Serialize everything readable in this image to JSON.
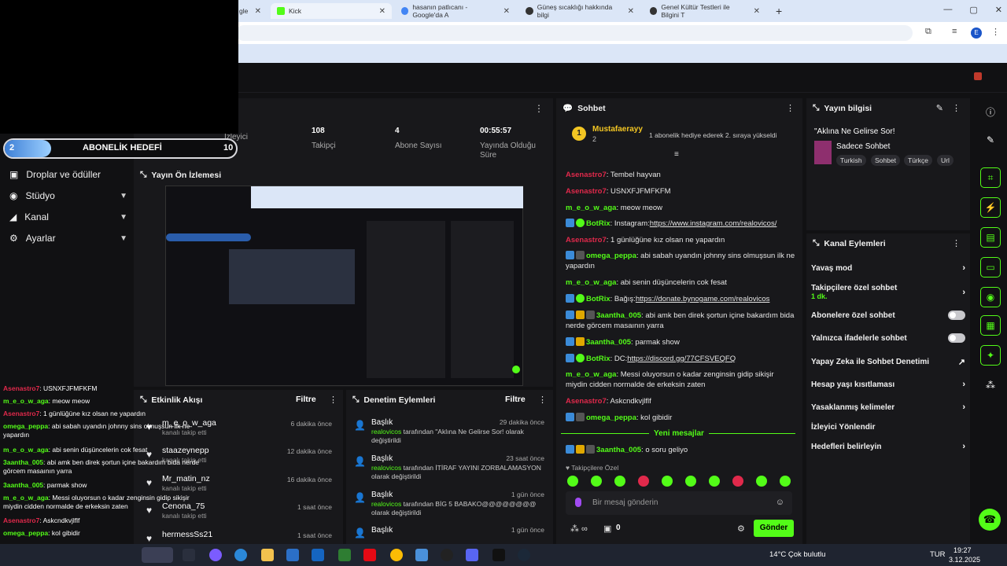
{
  "browser": {
    "tabs": [
      {
        "title": "gle"
      },
      {
        "title": "Kick"
      },
      {
        "title": "hasanın patlıcanı - Google'da A"
      },
      {
        "title": "Güneş sıcaklığı hakkında bilgi"
      },
      {
        "title": "Genel Kültür Testleri ile Bilgini T"
      }
    ],
    "new_tab": "+",
    "controls": [
      "—",
      "▢",
      "✕"
    ],
    "profile": "E"
  },
  "goal": {
    "level": "2",
    "label": "ABONELİK HEDEFİ",
    "target": "10",
    "progress_fraction": 0.2
  },
  "stats": [
    {
      "value": "",
      "label": "İzleyici"
    },
    {
      "value": "108",
      "label": "Takipçi"
    },
    {
      "value": "4",
      "label": "Abone Sayısı"
    },
    {
      "value": "00:55:57",
      "label": "Yayında Olduğu Süre"
    }
  ],
  "sidebar": {
    "items": [
      {
        "label": "Droplar ve ödüller"
      },
      {
        "label": "Stüdyo"
      },
      {
        "label": "Kanal"
      },
      {
        "label": "Ayarlar"
      }
    ]
  },
  "preview": {
    "title": "Yayın Ön İzlemesi"
  },
  "activity": {
    "title": "Etkinlik Akışı",
    "filter": "Filtre",
    "items": [
      {
        "name": "m_e_o_w_aga",
        "sub": "kanalı takip etti",
        "time": "6 dakika önce"
      },
      {
        "name": "staazeynepp",
        "sub": "kanalı takip etti",
        "time": "12 dakika önce"
      },
      {
        "name": "Mr_matin_nz",
        "sub": "kanalı takip etti",
        "time": "16 dakika önce"
      },
      {
        "name": "Cenona_75",
        "sub": "kanalı takip etti",
        "time": "1 saat önce"
      },
      {
        "name": "hermessSs21",
        "sub": "",
        "time": "1 saat önce"
      }
    ]
  },
  "moderation": {
    "title": "Denetim Eylemleri",
    "filter": "Filtre",
    "items": [
      {
        "title": "Başlık",
        "time": "29 dakika önce",
        "actor": "realovicos",
        "text": " tarafından \"Aklına Ne Gelirse Sor! olarak değiştirildi"
      },
      {
        "title": "Başlık",
        "time": "23 saat önce",
        "actor": "realovicos",
        "text": " tarafından İTİRAF YAYINI ZORBALAMASYON olarak değiştirildi"
      },
      {
        "title": "Başlık",
        "time": "1 gün önce",
        "actor": "realovicos",
        "text": " tarafından BİG 5 BABAKO@@@@@@@@ olarak değiştirildi"
      },
      {
        "title": "Başlık",
        "time": "1 gün önce",
        "actor": "",
        "text": ""
      }
    ]
  },
  "overlay_chat": [
    {
      "user": "Asenastro7",
      "msg": "USNXFJFMFKFM",
      "color": "red"
    },
    {
      "user": "m_e_o_w_aga",
      "msg": "meow meow",
      "color": "green"
    },
    {
      "user": "Asenastro7",
      "msg": "1 günlüğüne kız olsan ne yapardın",
      "color": "red"
    },
    {
      "user": "omega_peppa",
      "msg": "abi sabah uyandın johnny sins olmuşsun ilk ne yapardın",
      "color": "green"
    },
    {
      "user": "m_e_o_w_aga",
      "msg": "abi senin düşüncelerin cok fesat",
      "color": "green"
    },
    {
      "user": "3aantha_005",
      "msg": "abi amk ben direk şortun içine bakardım bida nerde görcem masaının yarra",
      "color": "green"
    },
    {
      "user": "3aantha_005",
      "msg": "parmak show",
      "color": "green"
    },
    {
      "user": "m_e_o_w_aga",
      "msg": "Messi oluyorsun o kadar zenginsin gidip sikişir miydin cidden normalde de erkeksin zaten",
      "color": "green"
    },
    {
      "user": "Asenastro7",
      "msg": "Askcndkvjlflf",
      "color": "red"
    },
    {
      "user": "omega_peppa",
      "msg": "kol gibidir",
      "color": "green"
    }
  ],
  "chat": {
    "title": "Sohbet",
    "pinned_user": "Mustafaerayy",
    "pinned_count": "2",
    "pinned_msg": "1 abonelik hediye ederek 2. sıraya yükseldi",
    "messages": [
      {
        "user": "Asenastro7",
        "msg": "Tembel hayvan",
        "color": "red"
      },
      {
        "user": "Asenastro7",
        "msg": "USNXFJFMFKFM",
        "color": "red"
      },
      {
        "user": "m_e_o_w_aga",
        "msg": "meow meow",
        "color": "green"
      },
      {
        "user": "BotRix",
        "msg": "Instagram:",
        "link": "https://www.instagram.com/realovicos/",
        "color": "green"
      },
      {
        "user": "Asenastro7",
        "msg": "1 günlüğüne kız olsan ne yapardın",
        "color": "red"
      },
      {
        "user": "omega_peppa",
        "msg": "abi sabah uyandın johnny sins olmuşsun ilk ne yapardın",
        "color": "green"
      },
      {
        "user": "m_e_o_w_aga",
        "msg": "abi senin düşüncelerin cok fesat",
        "color": "green"
      },
      {
        "user": "BotRix",
        "msg": "Bağış:",
        "link": "https://donate.bynogame.com/realovicos",
        "color": "green"
      },
      {
        "user": "3aantha_005",
        "msg": "abi amk ben direk şortun içine bakardım bida nerde görcem masaının yarra",
        "color": "green"
      },
      {
        "user": "3aantha_005",
        "msg": "parmak show",
        "color": "green"
      },
      {
        "user": "BotRix",
        "msg": "DC:",
        "link": "https://discord.gg/77CFSVEQFQ",
        "color": "green"
      },
      {
        "user": "m_e_o_w_aga",
        "msg": "Messi oluyorsun o kadar zenginsin gidip sikişir miydin cidden normalde de erkeksin zaten",
        "color": "green"
      },
      {
        "user": "Asenastro7",
        "msg": "Askcndkvjlflf",
        "color": "red"
      },
      {
        "user": "omega_peppa",
        "msg": "kol gibidir",
        "color": "green"
      }
    ],
    "new_messages": "Yeni mesajlar",
    "after_new": {
      "user": "3aantha_005",
      "msg": "o soru geliyo"
    },
    "followers_only": "Takipçilere Özel",
    "input_placeholder": "Bir mesaj gönderin",
    "counter": "0",
    "send_label": "Gönder"
  },
  "stream_info": {
    "title": "Yayın bilgisi",
    "stream_title": "\"Aklına Ne Gelirse Sor!",
    "category": "Sadece Sohbet",
    "tags": [
      "Turkish",
      "Sohbet",
      "Türkçe",
      "Url"
    ]
  },
  "channel_actions": {
    "title": "Kanal Eylemleri",
    "items": [
      {
        "label": "Yavaş mod",
        "kind": "arrow"
      },
      {
        "label": "Takipçilere özel sohbet",
        "sub": "1 dk.",
        "kind": "arrow"
      },
      {
        "label": "Abonelere özel sohbet",
        "kind": "toggle"
      },
      {
        "label": "Yalnızca ifadelerle sohbet",
        "kind": "toggle"
      },
      {
        "label": "Yapay Zeka ile Sohbet Denetimi",
        "kind": "ext"
      },
      {
        "label": "Hesap yaşı kısıtlaması",
        "kind": "arrow"
      },
      {
        "label": "Yasaklanmış kelimeler",
        "kind": "arrow"
      },
      {
        "label": "İzleyici Yönlendir",
        "kind": "none"
      },
      {
        "label": "Hedefleri belirleyin",
        "kind": "arrow"
      }
    ]
  },
  "taskbar": {
    "weather": "14°C  Çok bulutlu",
    "lang": "TUR",
    "time": "19:27",
    "date": "3.12.2025"
  },
  "colors": {
    "accent": "#53fc18",
    "danger": "#e0294b",
    "panel": "#18181b"
  }
}
